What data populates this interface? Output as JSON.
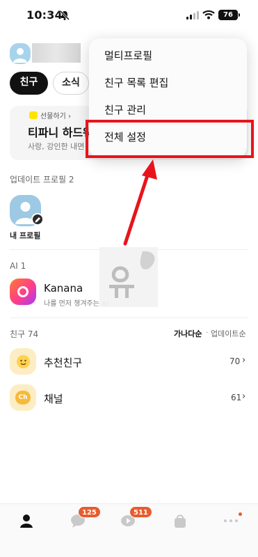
{
  "status_bar": {
    "time": "10:34",
    "battery": "76",
    "icons": [
      "bell-off-icon",
      "signal-icon",
      "wifi-icon",
      "battery-icon"
    ]
  },
  "header": {
    "tabs": [
      {
        "label": "친구",
        "active": true
      },
      {
        "label": "소식",
        "active": false
      }
    ]
  },
  "gift_card": {
    "tag": "선물하기 ›",
    "title": "티파니 하드웨",
    "subtitle": "사랑, 강인한 내면"
  },
  "update_section": {
    "label": "업데이트 프로필 2",
    "my_profile": "내 프로필"
  },
  "ai_section": {
    "label": "AI 1",
    "name": "Kanana",
    "subtitle": "나를 먼저 챙겨주는 AI"
  },
  "friends_section": {
    "label": "친구 74",
    "sort_active": "가나다순",
    "sort_separator": "·",
    "sort_other": "업데이트순",
    "rows": [
      {
        "name": "추천친구",
        "count": "70",
        "chevron": "›"
      },
      {
        "name": "채널",
        "count": "61",
        "chevron": "›",
        "icon_text": "Ch"
      }
    ]
  },
  "menu": {
    "items": [
      "멀티프로필",
      "친구 목록 편집",
      "친구 관리",
      "전체 설정"
    ],
    "highlighted_index": 3
  },
  "annotation": {
    "color": "#e8141c"
  },
  "tabbar": {
    "chat_badge": "125",
    "openchat_badge": "511",
    "icons": [
      "person-icon",
      "chat-bubble-icon",
      "open-chat-icon",
      "shopping-bag-icon",
      "more-icon"
    ]
  },
  "colors": {
    "accent_badge": "#e85c2d",
    "active_pill": "#111111",
    "gift_badge": "#fee500"
  }
}
